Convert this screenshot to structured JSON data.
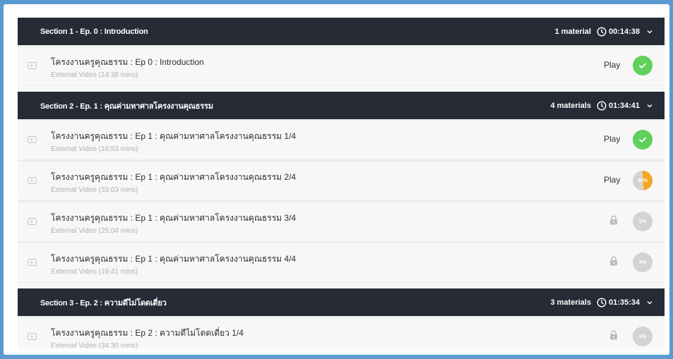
{
  "colors": {
    "header_bg": "#262b35",
    "done_green": "#5fd05a",
    "progress_orange": "#f5a623",
    "pending_grey": "#d3d3d3"
  },
  "sections": [
    {
      "title": "Section 1 - Ep. 0 : Introduction",
      "count": "1 material",
      "duration": "00:14:38",
      "items": [
        {
          "title": "โครงงานครูคุณธรรม : Ep 0 : Introduction",
          "sub": "External Video  (14:38 mins)",
          "action": "Play",
          "state": "done"
        }
      ]
    },
    {
      "title": "Section 2 - Ep. 1 : คุณค่ามหาศาลโครงงานคุณธรรม",
      "count": "4 materials",
      "duration": "01:34:41",
      "items": [
        {
          "title": "โครงงานครูคุณธรรม : Ep 1 : คุณค่ามหาศาลโครงงานคุณธรรม 1/4",
          "sub": "External Video  (16:53 mins)",
          "action": "Play",
          "state": "done"
        },
        {
          "title": "โครงงานครูคุณธรรม : Ep 1 : คุณค่ามหาศาลโครงงานคุณธรรม 2/4",
          "sub": "External Video  (33:03 mins)",
          "action": "Play",
          "state": "progress",
          "percent_label": "48%",
          "progress": 0.48
        },
        {
          "title": "โครงงานครูคุณธรรม : Ep 1 : คุณค่ามหาศาลโครงงานคุณธรรม 3/4",
          "sub": "External Video  (25:04 mins)",
          "state": "locked",
          "percent_label": "0%"
        },
        {
          "title": "โครงงานครูคุณธรรม : Ep 1 : คุณค่ามหาศาลโครงงานคุณธรรม 4/4",
          "sub": "External Video  (19:41 mins)",
          "state": "locked",
          "percent_label": "0%"
        }
      ]
    },
    {
      "title": "Section 3 - Ep. 2 : ความดีไม่โดดเดี่ยว",
      "count": "3 materials",
      "duration": "01:35:34",
      "items": [
        {
          "title": "โครงงานครูคุณธรรม : Ep 2 : ความดีไม่โดดเดี่ยว 1/4",
          "sub": "External Video  (34:30 mins)",
          "state": "locked",
          "percent_label": "0%"
        }
      ]
    }
  ]
}
